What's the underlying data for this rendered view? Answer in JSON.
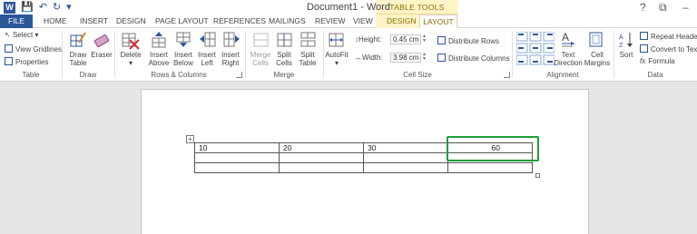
{
  "window": {
    "title": "Document1 - Word",
    "context_band": "TABLE TOOLS",
    "controls": [
      "?",
      "⧉",
      "–"
    ]
  },
  "tabs": {
    "file": "FILE",
    "items": [
      "HOME",
      "INSERT",
      "DESIGN",
      "PAGE LAYOUT",
      "REFERENCES",
      "MAILINGS",
      "REVIEW",
      "VIEW"
    ],
    "context_design": "DESIGN",
    "context_layout": "LAYOUT"
  },
  "ribbon": {
    "table_group": {
      "label": "Table",
      "select": "Select",
      "view_gridlines": "View Gridlines",
      "properties": "Properties"
    },
    "draw_group": {
      "label": "Draw",
      "draw_table": [
        "Draw",
        "Table"
      ],
      "eraser": "Eraser"
    },
    "rows_columns_group": {
      "label": "Rows & Columns",
      "delete": "Delete",
      "insert_above": [
        "Insert",
        "Above"
      ],
      "insert_below": [
        "Insert",
        "Below"
      ],
      "insert_left": [
        "Insert",
        "Left"
      ],
      "insert_right": [
        "Insert",
        "Right"
      ]
    },
    "merge_group": {
      "label": "Merge",
      "merge_cells": [
        "Merge",
        "Cells"
      ],
      "split_cells": [
        "Split",
        "Cells"
      ],
      "split_table": [
        "Split",
        "Table"
      ]
    },
    "cell_size_group": {
      "label": "Cell Size",
      "autofit": "AutoFit",
      "height_label": "Height:",
      "height_value": "0.45 cm",
      "width_label": "Width:",
      "width_value": "3.98 cm",
      "distribute_rows": "Distribute Rows",
      "distribute_columns": "Distribute Columns"
    },
    "alignment_group": {
      "label": "Alignment",
      "text_direction": [
        "Text",
        "Direction"
      ],
      "cell_margins": [
        "Cell",
        "Margins"
      ]
    },
    "data_group": {
      "label": "Data",
      "sort": "Sort",
      "repeat_header": "Repeat Header",
      "convert_to_text": "Convert to Text",
      "formula": "Formula"
    }
  },
  "table": {
    "rows": [
      [
        "10",
        "20",
        "30",
        "60"
      ],
      [
        "",
        "",
        "",
        ""
      ],
      [
        "",
        "",
        "",
        ""
      ]
    ]
  },
  "colors": {
    "word_blue": "#2b579a",
    "context_yellow": "#fef4c7",
    "highlight_green": "#1f9d3a"
  }
}
